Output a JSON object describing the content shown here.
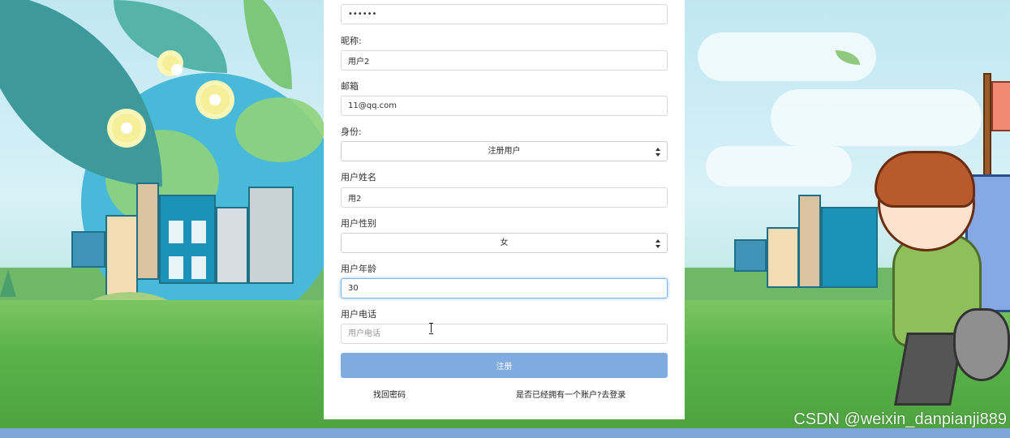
{
  "form": {
    "password": {
      "value": "••••••"
    },
    "nickname": {
      "label": "昵称:",
      "value": "用户2"
    },
    "email": {
      "label": "邮箱",
      "value": "11@qq.com"
    },
    "role": {
      "label": "身份:",
      "selected": "注册用户"
    },
    "real_name": {
      "label": "用户姓名",
      "value": "用2"
    },
    "gender": {
      "label": "用户性别",
      "selected": "女"
    },
    "age": {
      "label": "用户年龄",
      "value": "30"
    },
    "phone": {
      "label": "用户电话",
      "placeholder": "用户电话",
      "value": ""
    },
    "submit_label": "注册",
    "forgot_password_link": "找回密码",
    "login_link": "是否已经拥有一个账户?去登录"
  },
  "watermark": "CSDN @weixin_danpianji889",
  "colors": {
    "submit_button": "#80abe0",
    "focus_border": "#7fb4e8",
    "bottom_bar": "#7fa6d8"
  }
}
